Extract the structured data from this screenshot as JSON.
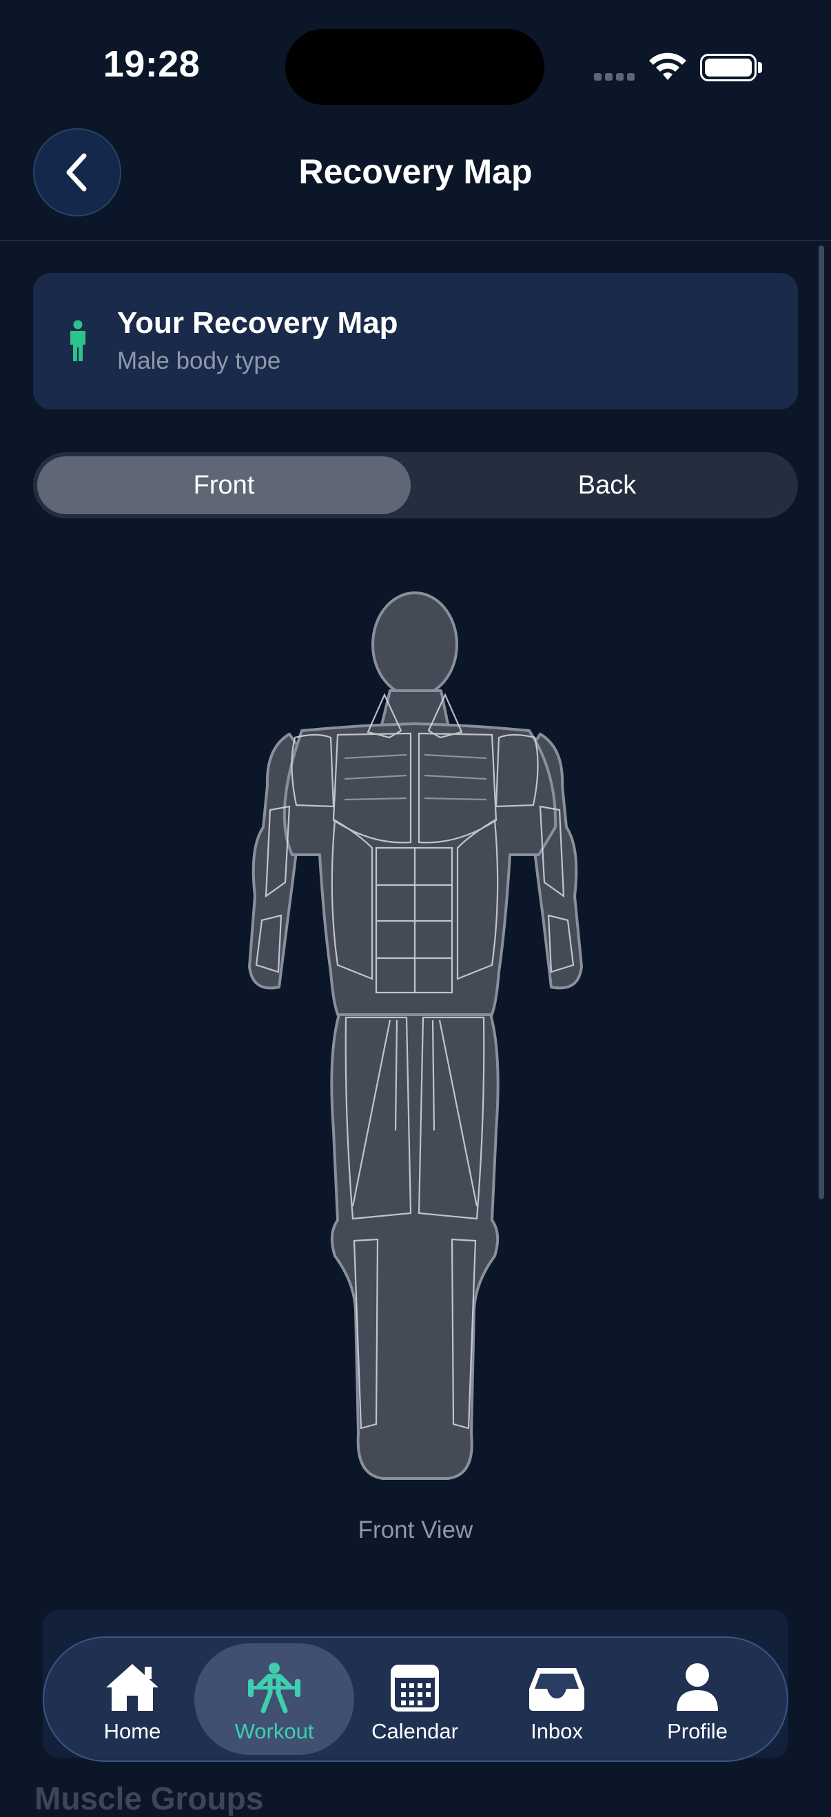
{
  "status_bar": {
    "time": "19:28"
  },
  "header": {
    "title": "Recovery Map"
  },
  "recovery_card": {
    "title": "Your Recovery Map",
    "subtitle": "Male body type"
  },
  "segment": {
    "front_label": "Front",
    "back_label": "Back",
    "selected": "Front"
  },
  "body_view": {
    "caption": "Front View"
  },
  "section": {
    "title": "Muscle Groups"
  },
  "tab_bar": {
    "items": [
      {
        "label": "Home",
        "icon": "home-icon"
      },
      {
        "label": "Workout",
        "icon": "workout-icon",
        "active": true
      },
      {
        "label": "Calendar",
        "icon": "calendar-icon"
      },
      {
        "label": "Inbox",
        "icon": "inbox-icon"
      },
      {
        "label": "Profile",
        "icon": "profile-icon"
      }
    ]
  },
  "colors": {
    "background": "#0b1628",
    "card": "#1a2a4a",
    "accent": "#3ecfb0",
    "person_icon": "#2cc38b",
    "body_fill": "#454b56",
    "body_stroke": "#8a909b"
  }
}
